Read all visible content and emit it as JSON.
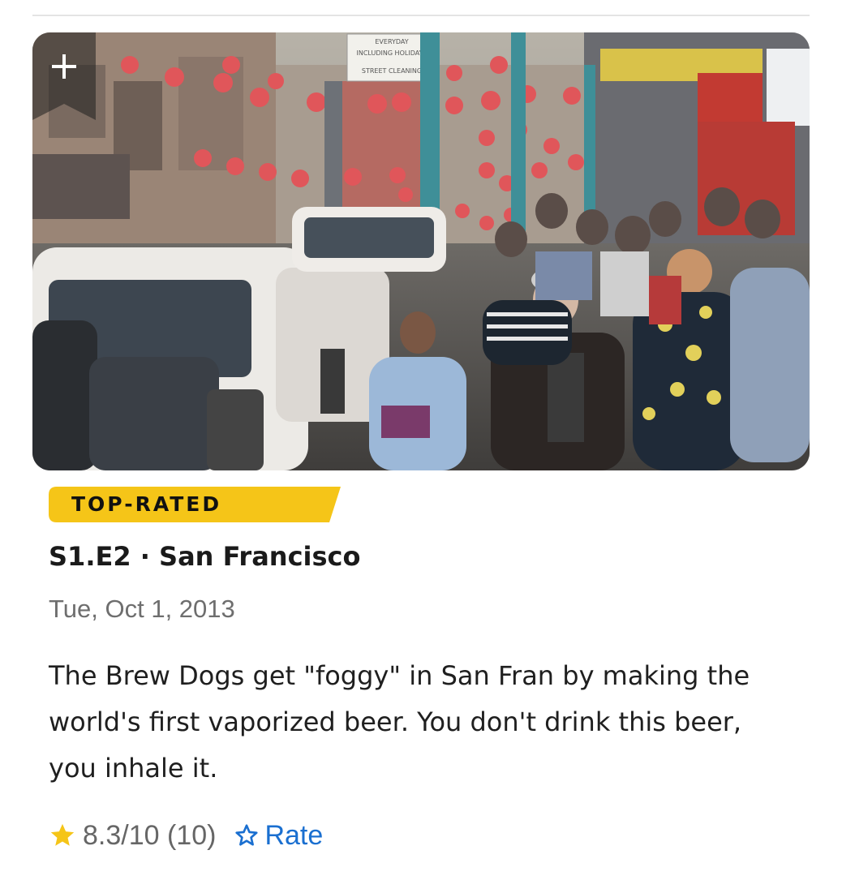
{
  "episode": {
    "badge": "TOP-RATED",
    "title": "S1.E2 · San Francisco",
    "air_date": "Tue, Oct 1, 2013",
    "plot": "The Brew Dogs get \"foggy\" in San Fran by making the world's first vaporized beer. You don't drink this beer, you inhale it.",
    "rating": "8.3/10 (10)",
    "rate_label": "Rate"
  },
  "thumbnail": {
    "signs": [
      "EVERYDAY",
      "INCLUDING HOLIDAYS",
      "STREET CLEANING"
    ],
    "add_icon": "plus-icon"
  },
  "colors": {
    "badge": "#f5c518",
    "star": "#f5c518",
    "link": "#1a6fd0",
    "date": "#6e6e6e"
  },
  "icons": {
    "rating": "star-filled-icon",
    "rate": "star-outline-icon"
  }
}
